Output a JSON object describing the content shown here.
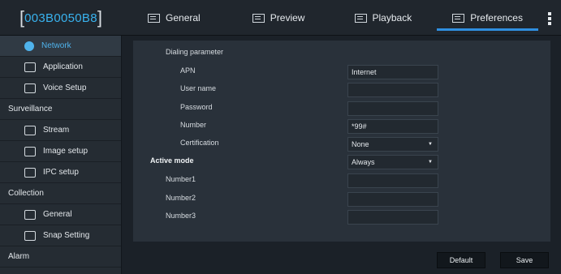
{
  "device": {
    "id": "003B0050B8",
    "bracket_left": "[",
    "bracket_right": "]"
  },
  "tabs": [
    {
      "label": "General",
      "icon": "grid-icon",
      "active": false
    },
    {
      "label": "Preview",
      "icon": "monitor-icon",
      "active": false
    },
    {
      "label": "Playback",
      "icon": "calendar-icon",
      "active": false
    },
    {
      "label": "Preferences",
      "icon": "bars-icon",
      "active": true
    }
  ],
  "sidebar": {
    "items": [
      {
        "type": "item",
        "label": "Network",
        "icon": "globe-icon",
        "active": true
      },
      {
        "type": "item",
        "label": "Application",
        "icon": "application-icon",
        "active": false
      },
      {
        "type": "item",
        "label": "Voice Setup",
        "icon": "voice-icon",
        "active": false
      },
      {
        "type": "section",
        "label": "Surveillance"
      },
      {
        "type": "item",
        "label": "Stream",
        "icon": "stream-icon",
        "active": false
      },
      {
        "type": "item",
        "label": "Image setup",
        "icon": "camera-icon",
        "active": false
      },
      {
        "type": "item",
        "label": "IPC setup",
        "icon": "ipc-icon",
        "active": false
      },
      {
        "type": "section",
        "label": "Collection"
      },
      {
        "type": "item",
        "label": "General",
        "icon": "gear-icon",
        "active": false
      },
      {
        "type": "item",
        "label": "Snap Setting",
        "icon": "snapshot-icon",
        "active": false
      },
      {
        "type": "section",
        "label": "Alarm"
      }
    ]
  },
  "form": {
    "dialing_parameter_label": "Dialing parameter",
    "apn_label": "APN",
    "apn_value": "Internet",
    "username_label": "User name",
    "username_value": "",
    "password_label": "Password",
    "password_value": "",
    "number_label": "Number",
    "number_value": "*99#",
    "certification_label": "Certification",
    "certification_value": "None",
    "active_mode_label": "Active mode",
    "active_mode_value": "Always",
    "number1_label": "Number1",
    "number1_value": "",
    "number2_label": "Number2",
    "number2_value": "",
    "number3_label": "Number3",
    "number3_value": ""
  },
  "buttons": {
    "default_label": "Default",
    "save_label": "Save"
  },
  "colors": {
    "accent": "#2f8fe0",
    "device_id": "#39b3ef",
    "active_sidebar_text": "#4fb3ec"
  }
}
